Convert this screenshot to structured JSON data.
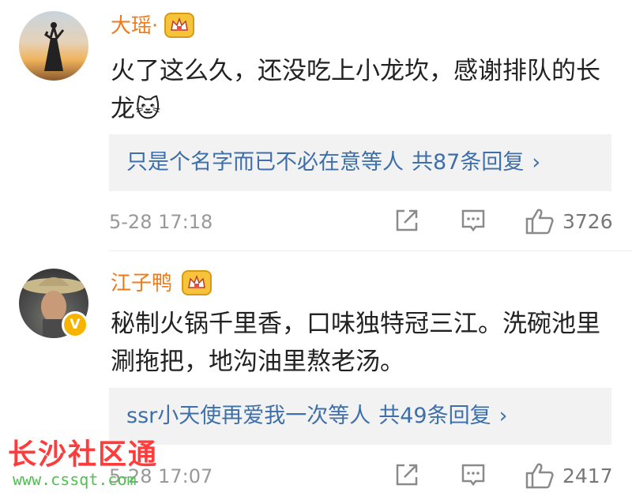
{
  "comments": [
    {
      "username": "大瑶·",
      "text": "火了这么久，还没吃上小龙坎，感谢排队的长龙",
      "emoji": "🐱",
      "reply_preview": "只是个名字而已不必在意等人",
      "reply_count": "共87条回复",
      "timestamp": "5-28 17:18",
      "likes": "3726"
    },
    {
      "username": "江子鸭",
      "text": "秘制火锅千里香，口味独特冠三江。洗碗池里涮拖把，地沟油里熬老汤。",
      "reply_preview": "ssr小天使再爱我一次等人",
      "reply_count": "共49条回复",
      "timestamp": "5-28 17:07",
      "likes": "2417",
      "verified_glyph": "V"
    }
  ],
  "icons": {
    "share": "share-icon",
    "comment": "comment-icon",
    "like": "thumbs-up-icon",
    "vip": "crown-vip-icon",
    "chevron": "chevron-right-icon"
  },
  "chevron_glyph": "›",
  "watermark": {
    "title": "长沙社区通",
    "url": "www.cssqt.com"
  },
  "colors": {
    "username": "#f07a18",
    "reply_link": "#3e6fa8",
    "meta": "#999999",
    "vip": "#f6c43a",
    "verified": "#f6b400"
  }
}
